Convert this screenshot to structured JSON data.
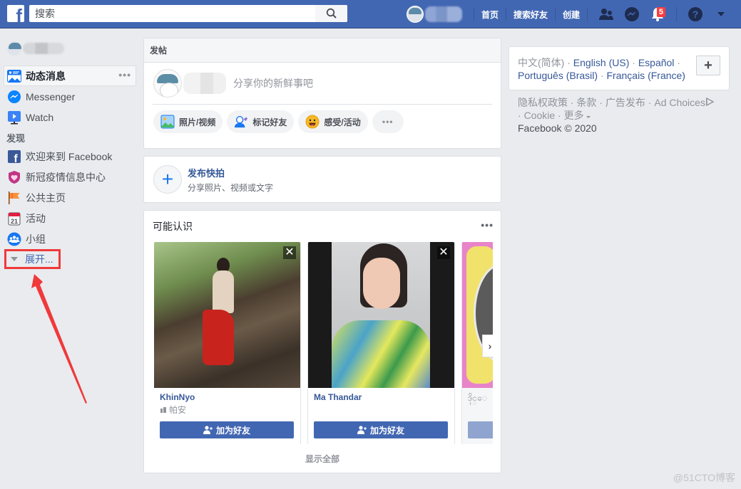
{
  "topbar": {
    "logo": "f",
    "search_placeholder": "搜索",
    "nav_links": [
      "首页",
      "搜索好友",
      "创建"
    ],
    "notifications_count": "5",
    "brand_color": "#4267b2"
  },
  "left_nav": {
    "main_items": [
      {
        "label": "动态消息",
        "icon": "news-feed-icon",
        "active": true
      },
      {
        "label": "Messenger",
        "icon": "messenger-icon"
      },
      {
        "label": "Watch",
        "icon": "watch-icon"
      }
    ],
    "more_label": "•••",
    "section_title": "发现",
    "discover_items": [
      {
        "label": "欢迎来到 Facebook",
        "icon": "facebook-icon"
      },
      {
        "label": "新冠疫情信息中心",
        "icon": "covid-heart-icon"
      },
      {
        "label": "公共主页",
        "icon": "flag-icon"
      },
      {
        "label": "活动",
        "icon": "calendar-icon",
        "icon_text": "21"
      },
      {
        "label": "小组",
        "icon": "groups-icon"
      }
    ],
    "expand_label": "展开..."
  },
  "composer": {
    "title": "发帖",
    "placeholder": "分享你的新鲜事吧",
    "actions": [
      {
        "label": "照片/视频",
        "icon": "photo-icon"
      },
      {
        "label": "标记好友",
        "icon": "tag-friend-icon"
      },
      {
        "label": "感受/活动",
        "icon": "feeling-icon"
      }
    ],
    "more_label": "•••"
  },
  "stories": {
    "title": "发布快拍",
    "subtitle": "分享照片、视频或文字"
  },
  "pymk": {
    "title": "可能认识",
    "more_label": "•••",
    "people": [
      {
        "name": "KhinNyo",
        "meta": "帕安",
        "add_label": "加为好友"
      },
      {
        "name": "Ma Thandar",
        "meta": "",
        "add_label": "加为好友"
      },
      {
        "name": "ဒိုင္ေ",
        "meta": "",
        "add_label": ""
      }
    ],
    "show_all": "显示全部"
  },
  "right": {
    "current_lang": "中文(简体)",
    "languages": [
      "English (US)",
      "Español",
      "Português (Brasil)",
      "Français (France)"
    ],
    "footer_links": [
      "隐私权政策",
      "条款",
      "广告发布",
      "Ad Choices",
      "Cookie",
      "更多"
    ],
    "copyright": "Facebook © 2020"
  },
  "watermark": "@51CTO博客"
}
